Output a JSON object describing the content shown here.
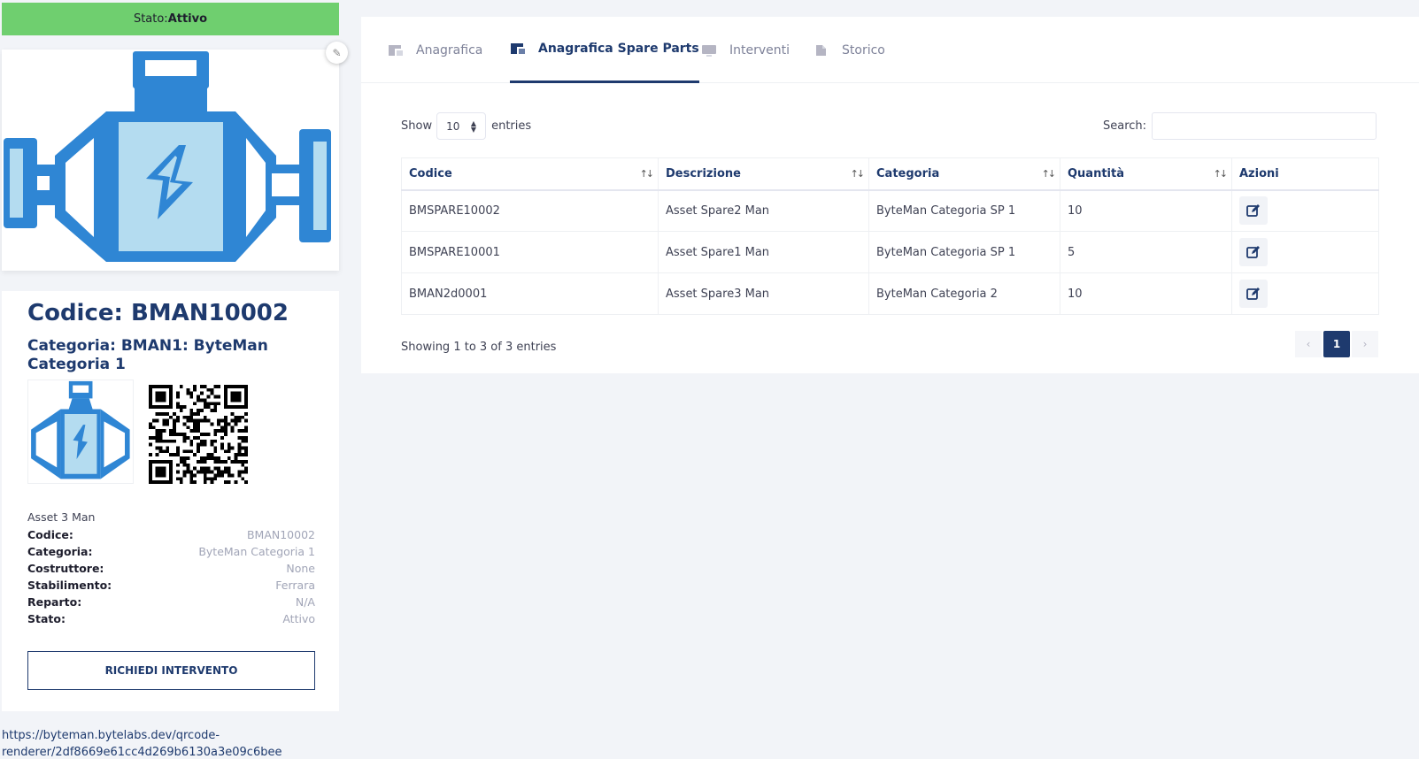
{
  "status": {
    "label": "Stato:",
    "value": "Attivo",
    "color": "#6fcf6f"
  },
  "asset": {
    "code_title": "Codice: BMAN10002",
    "category_title": "Categoria: BMAN1: ByteMan Categoria 1",
    "name": "Asset 3 Man",
    "details": [
      {
        "key": "Codice:",
        "value": "BMAN10002"
      },
      {
        "key": "Categoria:",
        "value": "ByteMan Categoria 1"
      },
      {
        "key": "Costruttore:",
        "value": "None"
      },
      {
        "key": "Stabilimento:",
        "value": "Ferrara"
      },
      {
        "key": "Reparto:",
        "value": "N/A"
      },
      {
        "key": "Stato:",
        "value": "Attivo"
      }
    ],
    "request_button": "RICHIEDI INTERVENTO",
    "qr_url": "https://byteman.bytelabs.dev/qrcode-renderer/2df8669e61cc4d269b6130a3e09c6bee"
  },
  "tabs": [
    {
      "label": "Anagrafica",
      "icon": "asset-icon",
      "active": false
    },
    {
      "label": "Anagrafica Spare Parts",
      "icon": "asset-icon",
      "active": true
    },
    {
      "label": "Interventi",
      "icon": "monitor-icon",
      "active": false
    },
    {
      "label": "Storico",
      "icon": "document-icon",
      "active": false
    }
  ],
  "table_controls": {
    "show_label": "Show",
    "entries_value": "10",
    "entries_label": "entries",
    "search_label": "Search:"
  },
  "table": {
    "headers": [
      "Codice",
      "Descrizione",
      "Categoria",
      "Quantità",
      "Azioni"
    ],
    "rows": [
      {
        "code": "BMSPARE10002",
        "description": "Asset Spare2 Man",
        "category": "ByteMan Categoria SP 1",
        "quantity": "10"
      },
      {
        "code": "BMSPARE10001",
        "description": "Asset Spare1 Man",
        "category": "ByteMan Categoria SP 1",
        "quantity": "5"
      },
      {
        "code": "BMAN2d0001",
        "description": "Asset Spare3 Man",
        "category": "ByteMan Categoria 2",
        "quantity": "10"
      }
    ]
  },
  "footer": {
    "showing": "Showing 1 to 3 of 3 entries",
    "current_page": "1"
  },
  "colors": {
    "primary": "#1e3a6e",
    "icon_blue": "#2f86d4",
    "icon_light": "#b4dcf0"
  }
}
